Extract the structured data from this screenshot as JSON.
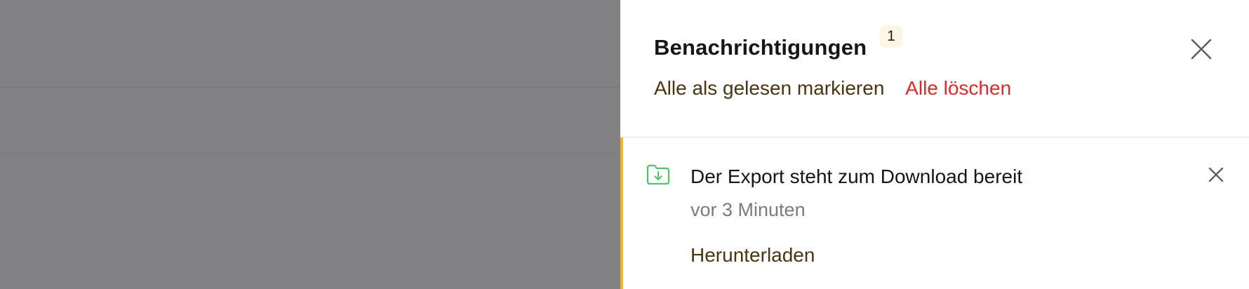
{
  "panel": {
    "title": "Benachrichtigungen",
    "unread_count": "1",
    "close_icon": "close-icon",
    "actions": {
      "mark_all_read": "Alle als gelesen markieren",
      "clear_all": "Alle löschen"
    }
  },
  "notifications": [
    {
      "icon": "folder-download-icon",
      "title": "Der Export steht zum Download bereit",
      "time": "vor 3 Minuten",
      "action_label": "Herunterladen",
      "status": "unread"
    }
  ],
  "colors": {
    "overlay": "#818184",
    "accent_unread": "#f2b52b",
    "link": "#4a3510",
    "danger": "#dd2a2a",
    "icon_success": "#4fc46a",
    "badge_bg": "#fdf5e5"
  }
}
